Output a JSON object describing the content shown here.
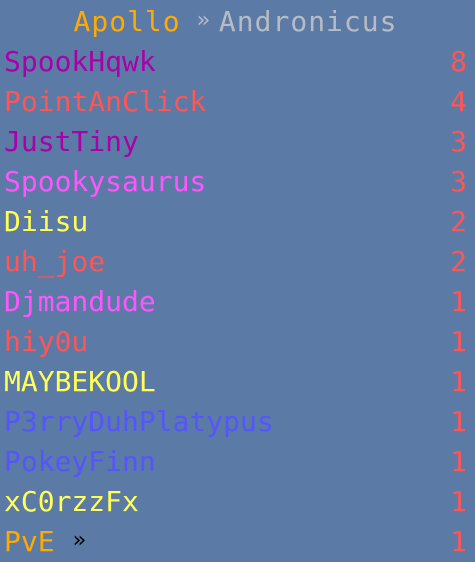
{
  "header": {
    "team": "Apollo",
    "separator": "»",
    "map": "Andronicus"
  },
  "colors": {
    "background": "#5b7aa6",
    "score": "#ff5555",
    "team_gold": "#ffaa00",
    "map_gray": "#b7bcc4"
  },
  "players": [
    {
      "name": "SpookHqwk",
      "score": "8",
      "color": "#aa00aa"
    },
    {
      "name": "PointAnClick",
      "score": "4",
      "color": "#ff5555"
    },
    {
      "name": "JustTiny",
      "score": "3",
      "color": "#aa00aa"
    },
    {
      "name": "Spookysaurus",
      "score": "3",
      "color": "#ff55ff"
    },
    {
      "name": "Diisu",
      "score": "2",
      "color": "#ffff55"
    },
    {
      "name": "uh_joe",
      "score": "2",
      "color": "#ff5555"
    },
    {
      "name": "Djmandude",
      "score": "1",
      "color": "#ff55ff"
    },
    {
      "name": "hiy0u",
      "score": "1",
      "color": "#ff5555"
    },
    {
      "name": "MAYBEKOOL",
      "score": "1",
      "color": "#ffff55"
    },
    {
      "name": "P3rryDuhPlatypus",
      "score": "1",
      "color": "#5555ff"
    },
    {
      "name": "PokeyFinn",
      "score": "1",
      "color": "#5555ff"
    },
    {
      "name": "xC0rzzFx",
      "score": "1",
      "color": "#ffff55"
    },
    {
      "name": "PvE",
      "score": "1",
      "color": "#ffaa00",
      "suffix": "»"
    }
  ]
}
